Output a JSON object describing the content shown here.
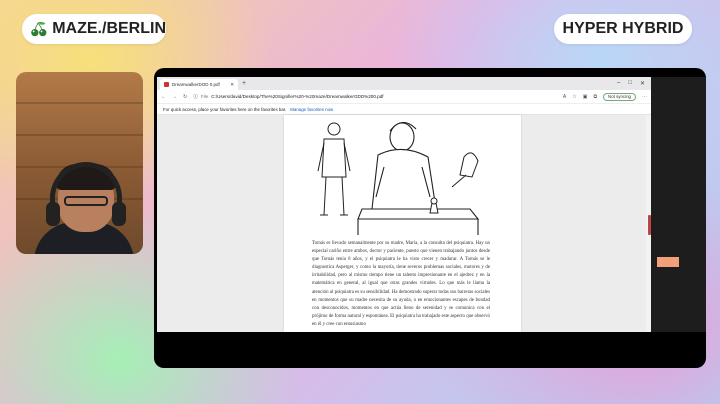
{
  "brand": {
    "name": "MAZE./BERLIN"
  },
  "mode": {
    "label": "HYPER HYBRID"
  },
  "browser": {
    "tab_title": "DreamwalkerDOD 0.pdf",
    "address_label": "File",
    "address_url": "C:/Users/david/Desktop/The%20Signifier%20-%20maze/DreamwalkerGDD%200.pdf",
    "sync_label": "Not syncing",
    "favbar_text": "For quick access, place your favorites here on the favorites bar.",
    "favbar_link": "Manage favorites now"
  },
  "document": {
    "paragraph": "Tomás es llevado semanalmente por su madre, María, a la consulta del psiquiatra. Hay un especial cariño entre ambos, doctor y paciente, puesto que vienen trabajando juntos desde que Tomás tenía 8 años, y el psiquiatra le ha visto crecer y madurar. A Tomás se le diagnostica Asperger, y como la mayoría, tiene severos problemas sociales, motores y de irritabilidad, pero al mismo tiempo tiene un talento impresionante en el ajedrez y en la matemática en general, al igual que otras grandes virtudes. Lo que más le llama la atención al psiquiatra es su sensibilidad. Ha demostrado superar todas sus barreras sociales en momentos que su madre necesita de su ayuda, o en emocionantes escapes de bondad con desconocidos, momentos en que actúa lleno de serenidad y se comunica con el prójimo de forma natural y espontánea. El psiquiatra ha trabajado este aspecto que observó en él y cree con entusiasmo"
  },
  "colors": {
    "accent": "#b44444",
    "sync_border": "#77aa77"
  }
}
